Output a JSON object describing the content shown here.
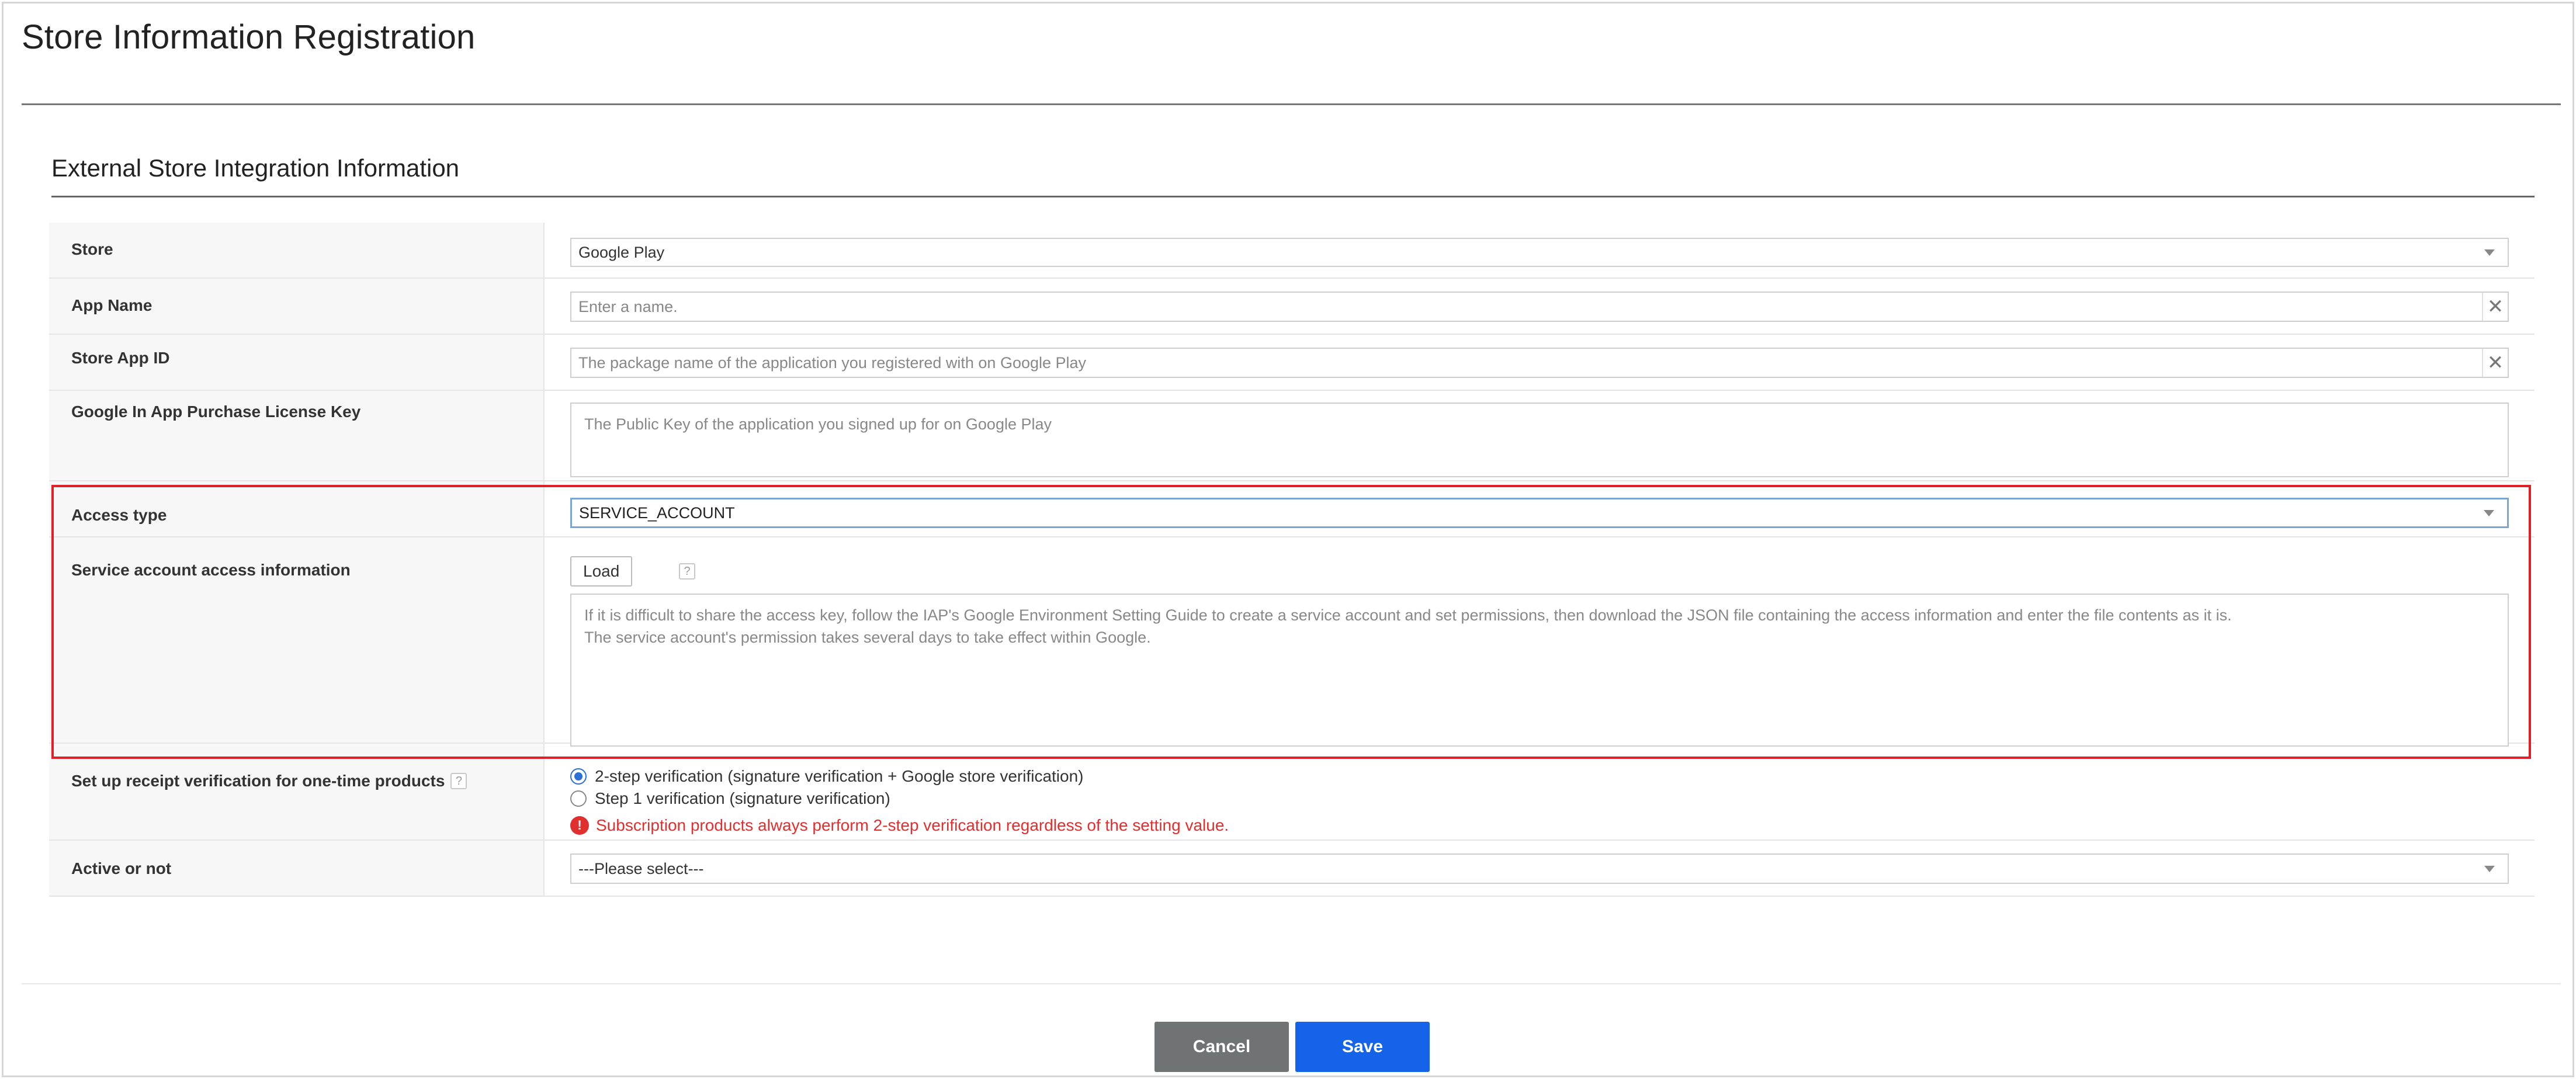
{
  "page": {
    "title": "Store Information Registration"
  },
  "section": {
    "title": "External Store Integration Information"
  },
  "form": {
    "store": {
      "label": "Store",
      "value": "Google Play"
    },
    "app_name": {
      "label": "App Name",
      "placeholder": "Enter a name."
    },
    "store_app_id": {
      "label": "Store App ID",
      "placeholder": "The package name of the application you registered with on Google Play"
    },
    "license_key": {
      "label": "Google In App Purchase License Key",
      "placeholder": "The Public Key of the application you signed up for on Google Play"
    },
    "access_type": {
      "label": "Access type",
      "value": "SERVICE_ACCOUNT"
    },
    "service_account": {
      "label": "Service account access information",
      "load_button": "Load",
      "help_glyph": "?",
      "placeholder_line1": "If it is difficult to share the access key, follow the IAP's Google Environment Setting Guide to create a service account and set permissions, then download the JSON file containing the access information and enter the file contents as it is.",
      "placeholder_line2": "The service account's permission takes several days to take effect within Google."
    },
    "receipt_verification": {
      "label": "Set up receipt verification for one-time products",
      "help_glyph": "?",
      "options": [
        {
          "label": "2-step verification (signature verification + Google store verification)",
          "checked": true
        },
        {
          "label": "Step 1 verification (signature verification)",
          "checked": false
        }
      ],
      "warning": "Subscription products always perform 2-step verification regardless of the setting value.",
      "warning_glyph": "!"
    },
    "active": {
      "label": "Active or not",
      "value": "---Please select---"
    }
  },
  "icons": {
    "clear": "✕",
    "dropdown": "chevron-down-icon"
  },
  "actions": {
    "cancel_label": "Cancel",
    "save_label": "Save"
  },
  "colors": {
    "highlight": "#e01f26",
    "primary": "#1463e8",
    "secondary": "#707374",
    "warning": "#e02f2f"
  }
}
